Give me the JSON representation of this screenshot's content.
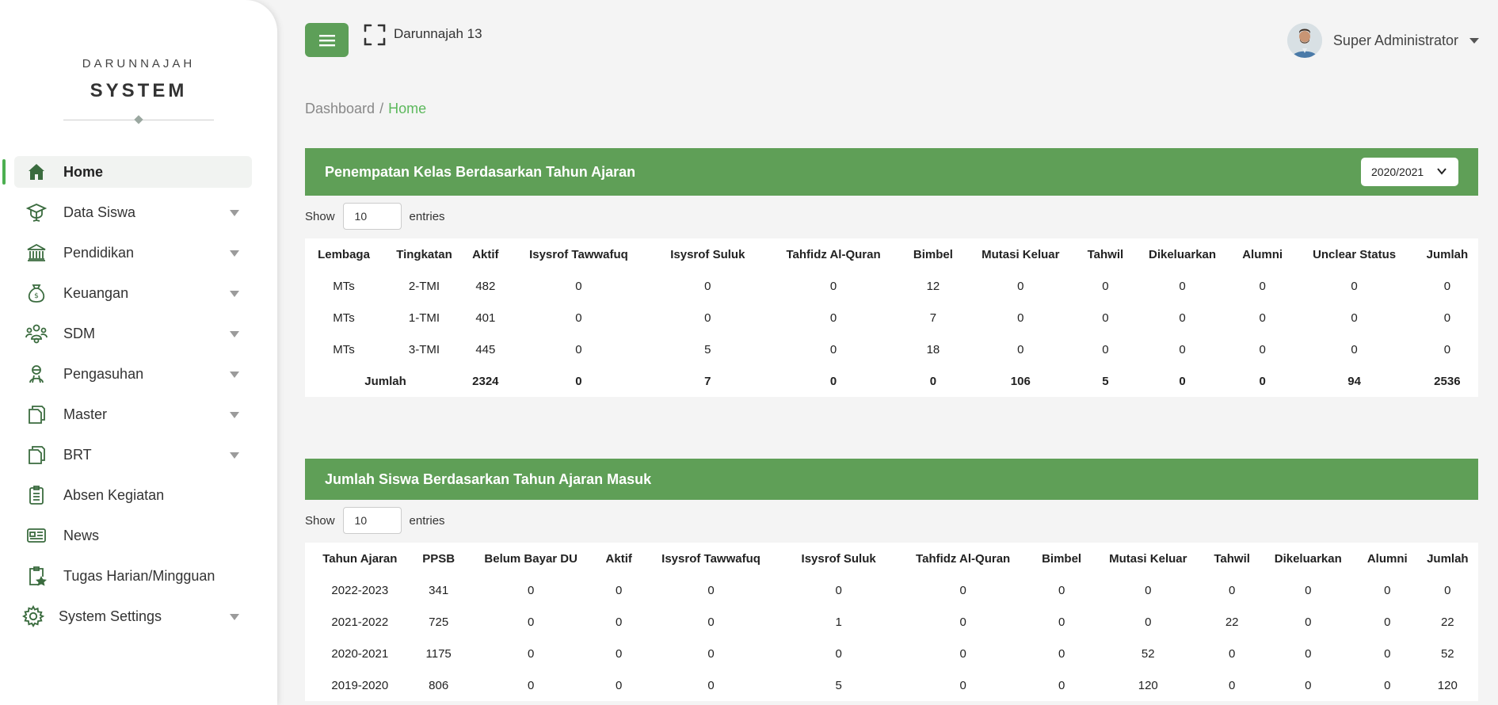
{
  "brand": {
    "top": "DARUNNAJAH",
    "main": "SYSTEM"
  },
  "sidebar": {
    "items": [
      {
        "label": "Home",
        "icon": "home-icon",
        "active": true,
        "has_caret": false
      },
      {
        "label": "Data Siswa",
        "icon": "graduation-cap-icon",
        "has_caret": true
      },
      {
        "label": "Pendidikan",
        "icon": "bank-icon",
        "has_caret": true
      },
      {
        "label": "Keuangan",
        "icon": "money-bag-icon",
        "has_caret": true
      },
      {
        "label": "SDM",
        "icon": "people-icon",
        "has_caret": true
      },
      {
        "label": "Pengasuhan",
        "icon": "caretaker-icon",
        "has_caret": true
      },
      {
        "label": "Master",
        "icon": "copy-icon",
        "has_caret": true
      },
      {
        "label": "BRT",
        "icon": "copy-icon",
        "has_caret": true
      },
      {
        "label": "Absen Kegiatan",
        "icon": "clipboard-list-icon",
        "has_caret": false
      },
      {
        "label": "News",
        "icon": "newspaper-icon",
        "has_caret": false
      },
      {
        "label": "Tugas Harian/Mingguan",
        "icon": "clipboard-star-icon",
        "has_caret": false
      },
      {
        "label": "System Settings",
        "icon": "gear-icon",
        "has_caret": true
      }
    ]
  },
  "topbar": {
    "site_title": "Darunnajah 13",
    "user_name": "Super Administrator"
  },
  "breadcrumb": {
    "root": "Dashboard",
    "sep": "/",
    "current": "Home"
  },
  "panel1": {
    "title": "Penempatan Kelas Berdasarkan Tahun Ajaran",
    "year_select": "2020/2021",
    "show_label": "Show",
    "show_value": "10",
    "entries_label": "entries",
    "headers": [
      "Lembaga",
      "Tingkatan",
      "Aktif",
      "Isysrof Tawwafuq",
      "Isysrof Suluk",
      "Tahfidz Al-Quran",
      "Bimbel",
      "Mutasi Keluar",
      "Tahwil",
      "Dikeluarkan",
      "Alumni",
      "Unclear Status",
      "Jumlah"
    ],
    "rows": [
      [
        "MTs",
        "2-TMI",
        "482",
        "0",
        "0",
        "0",
        "12",
        "0",
        "0",
        "0",
        "0",
        "0",
        "0"
      ],
      [
        "MTs",
        "1-TMI",
        "401",
        "0",
        "0",
        "0",
        "7",
        "0",
        "0",
        "0",
        "0",
        "0",
        "0"
      ],
      [
        "MTs",
        "3-TMI",
        "445",
        "0",
        "5",
        "0",
        "18",
        "0",
        "0",
        "0",
        "0",
        "0",
        "0"
      ]
    ],
    "total_label": "Jumlah",
    "totals": [
      "2324",
      "0",
      "7",
      "0",
      "0",
      "106",
      "5",
      "0",
      "0",
      "94",
      "2536"
    ]
  },
  "panel2": {
    "title": "Jumlah Siswa Berdasarkan Tahun Ajaran Masuk",
    "show_label": "Show",
    "show_value": "10",
    "entries_label": "entries",
    "headers": [
      "Tahun Ajaran",
      "PPSB",
      "Belum Bayar DU",
      "Aktif",
      "Isysrof Tawwafuq",
      "Isysrof Suluk",
      "Tahfidz Al-Quran",
      "Bimbel",
      "Mutasi Keluar",
      "Tahwil",
      "Dikeluarkan",
      "Alumni",
      "Jumlah"
    ],
    "rows": [
      [
        "2022-2023",
        "341",
        "0",
        "0",
        "0",
        "0",
        "0",
        "0",
        "0",
        "0",
        "0",
        "0",
        "0"
      ],
      [
        "2021-2022",
        "725",
        "0",
        "0",
        "0",
        "1",
        "0",
        "0",
        "0",
        "22",
        "0",
        "0",
        "22"
      ],
      [
        "2020-2021",
        "1175",
        "0",
        "0",
        "0",
        "0",
        "0",
        "0",
        "52",
        "0",
        "0",
        "0",
        "52"
      ],
      [
        "2019-2020",
        "806",
        "0",
        "0",
        "0",
        "5",
        "0",
        "0",
        "120",
        "0",
        "0",
        "0",
        "120"
      ]
    ]
  },
  "colors": {
    "accent": "#5f9f57",
    "active_bar": "#4caf50",
    "breadcrumb_current": "#5cb85c"
  }
}
